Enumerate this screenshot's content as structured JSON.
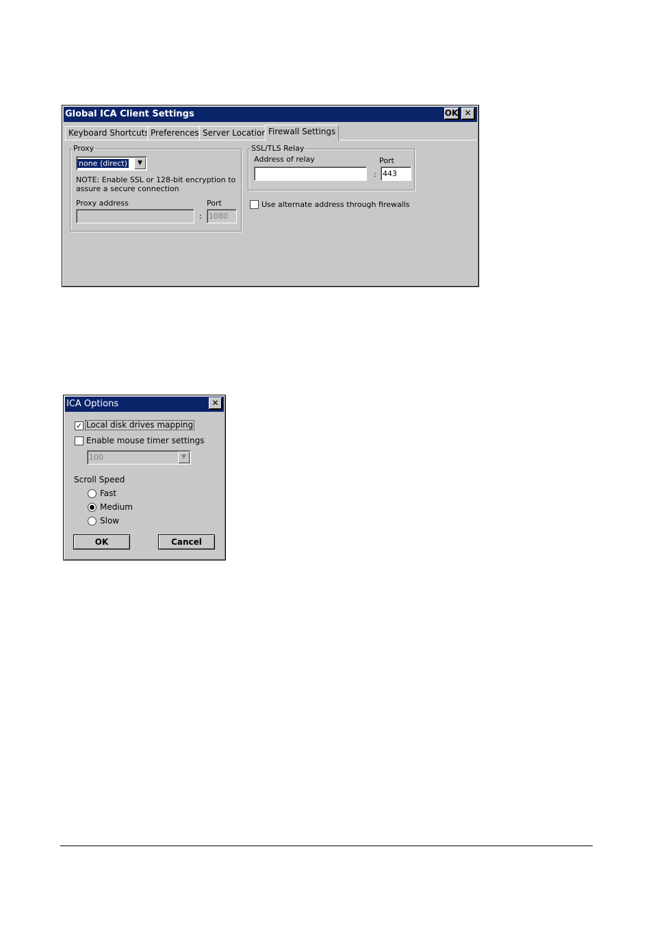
{
  "global_window": {
    "title": "Global ICA Client Settings",
    "ok_label": "OK",
    "close_label": "✕",
    "tabs": [
      {
        "label": "Keyboard Shortcuts"
      },
      {
        "label": "Preferences"
      },
      {
        "label": "Server Location"
      },
      {
        "label": "Firewall Settings"
      }
    ],
    "proxy": {
      "group_label": "Proxy",
      "selected": "none (direct)",
      "note": "NOTE: Enable SSL or 128-bit encryption to",
      "note2": "assure a secure connection",
      "address_label": "Proxy address",
      "port_label": "Port",
      "address_value": "",
      "port_value": "1080"
    },
    "relay": {
      "group_label": "SSL/TLS Relay",
      "address_label": "Address of relay",
      "port_label": "Port",
      "address_value": "",
      "port_value": "443"
    },
    "alternate_label": "Use alternate address through firewalls",
    "colon": ":"
  },
  "ica_options": {
    "title": "ICA Options",
    "close_label": "✕",
    "local_disk_label": "Local disk drives mapping",
    "local_disk_checked": true,
    "mouse_timer_label": "Enable mouse timer settings",
    "mouse_timer_checked": false,
    "mouse_timer_value": "100",
    "scroll_speed_label": "Scroll Speed",
    "speeds": [
      "Fast",
      "Medium",
      "Slow"
    ],
    "selected_speed": "Medium",
    "ok_label": "OK",
    "cancel_label": "Cancel",
    "check_mark": "✓"
  }
}
